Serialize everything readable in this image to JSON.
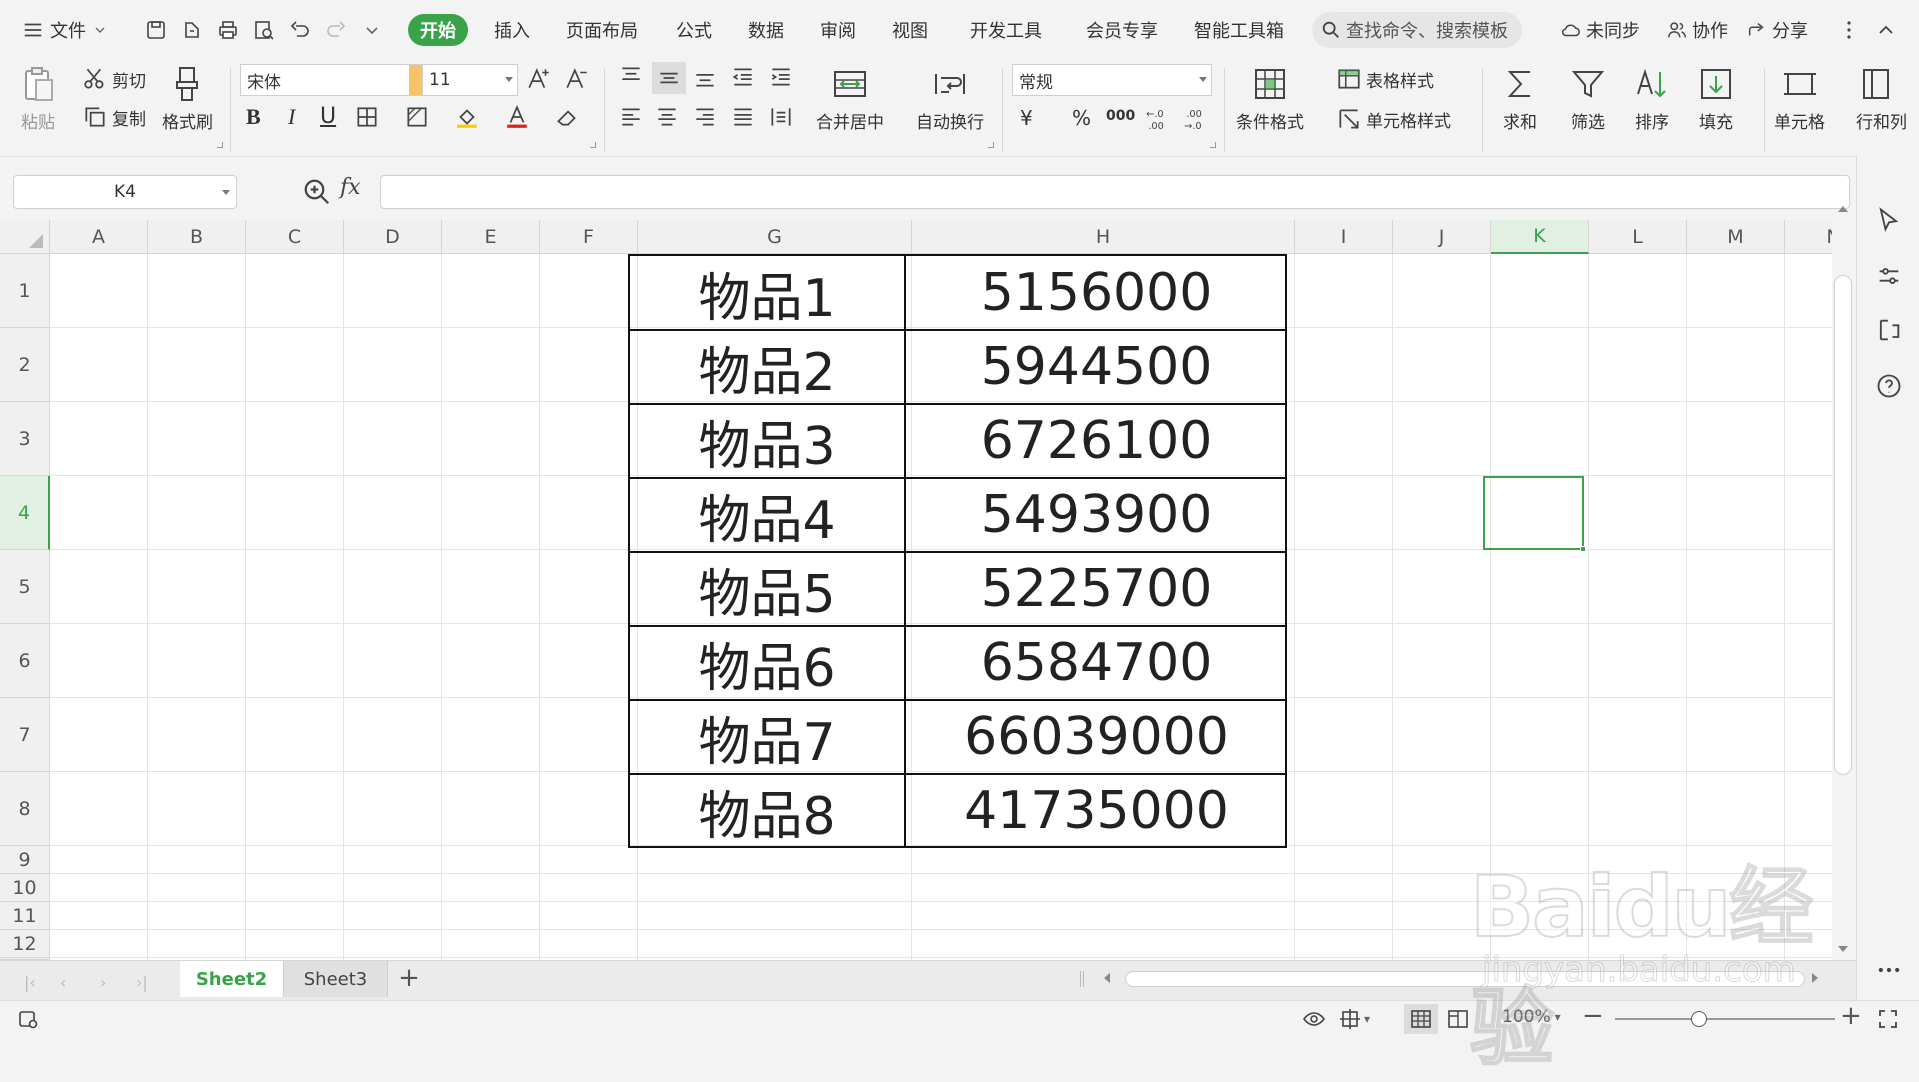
{
  "menu": {
    "file": "文件",
    "tabs": [
      "开始",
      "插入",
      "页面布局",
      "公式",
      "数据",
      "审阅",
      "视图",
      "开发工具",
      "会员专享",
      "智能工具箱"
    ],
    "search_placeholder": "查找命令、搜索模板",
    "sync": "未同步",
    "collab": "协作",
    "share": "分享"
  },
  "ribbon": {
    "paste": "粘贴",
    "cut": "剪切",
    "copy": "复制",
    "format_painter": "格式刷",
    "font_name": "宋体",
    "font_size": "11",
    "bold": "B",
    "italic": "I",
    "underline": "U",
    "merge_center": "合并居中",
    "wrap_text": "自动换行",
    "number_format": "常规",
    "currency": "¥",
    "percent": "%",
    "thousands": "000",
    "cond_format": "条件格式",
    "table_style": "表格样式",
    "cell_style": "单元格样式",
    "sum": "求和",
    "filter": "筛选",
    "sort": "排序",
    "fill": "填充",
    "cell": "单元格",
    "row_col": "行和列"
  },
  "formula_bar": {
    "name_box": "K4",
    "fx": "fx",
    "formula": ""
  },
  "grid": {
    "columns": [
      "A",
      "B",
      "C",
      "D",
      "E",
      "F",
      "G",
      "H",
      "I",
      "J",
      "K",
      "L",
      "M",
      "N"
    ],
    "rows": [
      "1",
      "2",
      "3",
      "4",
      "5",
      "6",
      "7",
      "8",
      "9",
      "10",
      "11",
      "12"
    ],
    "active_column": "K",
    "active_row": "4",
    "table": [
      {
        "item": "物品1",
        "value": "5156000"
      },
      {
        "item": "物品2",
        "value": "5944500"
      },
      {
        "item": "物品3",
        "value": "6726100"
      },
      {
        "item": "物品4",
        "value": "5493900"
      },
      {
        "item": "物品5",
        "value": "5225700"
      },
      {
        "item": "物品6",
        "value": "6584700"
      },
      {
        "item": "物品7",
        "value": "66039000"
      },
      {
        "item": "物品8",
        "value": "41735000"
      }
    ]
  },
  "sheets": {
    "tabs": [
      "Sheet2",
      "Sheet3"
    ],
    "active": "Sheet2",
    "add": "+"
  },
  "status": {
    "zoom": "100%",
    "zoom_fraction": 0.38
  },
  "watermark": {
    "logo": "Baidu经验",
    "url": "jingyan.baidu.com"
  },
  "colors": {
    "accent": "#3aa248",
    "grid": "#e4e4e4",
    "toolbar_bg": "#f3f3f3"
  }
}
